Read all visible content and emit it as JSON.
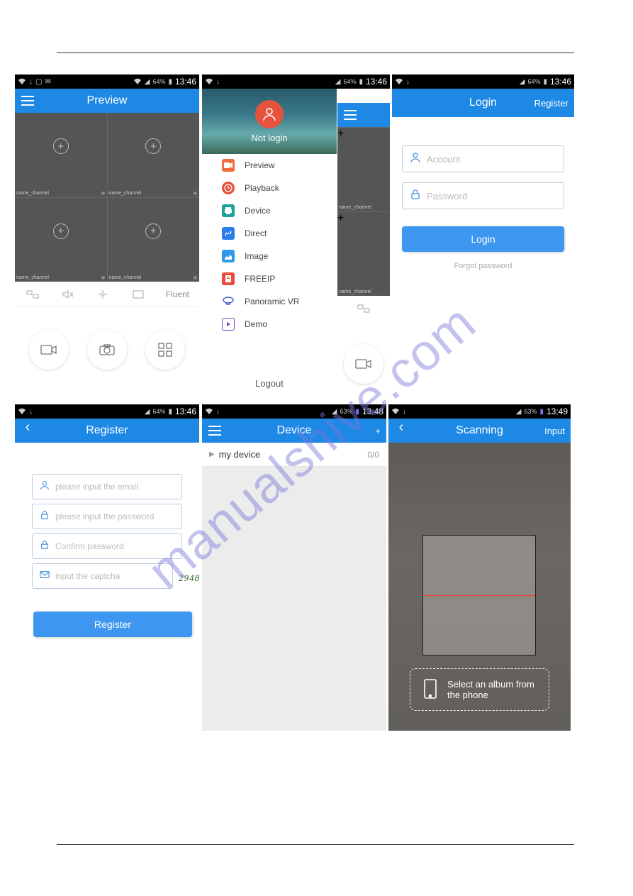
{
  "status": {
    "battery64": "64%",
    "battery63": "63%",
    "t1346": "13:46",
    "t1348": "13:48",
    "t1349": "13:49"
  },
  "watermark": "manualshive.com",
  "p1": {
    "title": "Preview",
    "cell_label": "name_channel",
    "fluent": "Fluent"
  },
  "p2": {
    "not_login": "Not login",
    "items": [
      {
        "label": "Preview",
        "color": "#f26b3a"
      },
      {
        "label": "Playback",
        "color": "#e5533d"
      },
      {
        "label": "Device",
        "color": "#1aa39a"
      },
      {
        "label": "Direct",
        "color": "#2b7de9"
      },
      {
        "label": "Image",
        "color": "#2b9ae9"
      },
      {
        "label": "FREEIP",
        "color": "#e94b3c"
      },
      {
        "label": "Panoramic VR",
        "color": "#3555c8"
      },
      {
        "label": "Demo",
        "color": "#7a3fd1"
      }
    ],
    "logout": "Logout"
  },
  "p3": {
    "title": "Login",
    "register": "Register",
    "account_ph": "Account",
    "password_ph": "Password",
    "login_btn": "Login",
    "forgot": "Forgot password"
  },
  "p4": {
    "title": "Register",
    "email_ph": "please input the email",
    "pwd_ph": "please input the password",
    "conf_ph": "Confirm password",
    "cap_ph": "input the captcha",
    "captcha": "2948",
    "register_btn": "Register"
  },
  "p5": {
    "title": "Device",
    "row_label": "my device",
    "row_count": "0/0"
  },
  "p6": {
    "title": "Scanning",
    "input": "Input",
    "album": "Select an album from the phone"
  }
}
